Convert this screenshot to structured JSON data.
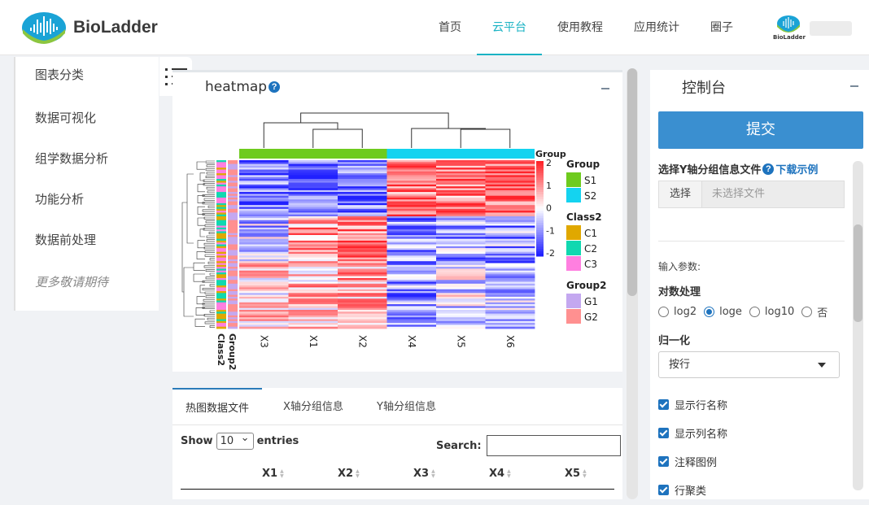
{
  "header": {
    "brand": "BioLadder",
    "nav": [
      "首页",
      "云平台",
      "使用教程",
      "应用统计",
      "圈子"
    ],
    "active_nav": "云平台",
    "avatar_brand": "BioLadder"
  },
  "sidebar": {
    "items": [
      "图表分类",
      "数据可视化",
      "组学数据分析",
      "功能分析",
      "数据前处理"
    ],
    "more": "更多敬请期待"
  },
  "panel": {
    "title": "heatmap",
    "help": "?"
  },
  "heatmap": {
    "columns": [
      "X3",
      "X1",
      "X2",
      "X4",
      "X5",
      "X6"
    ],
    "side_labels": [
      "Class2",
      "Group2"
    ],
    "top_annotation_label": "Group",
    "colorbar_ticks": [
      "2",
      "1",
      "0",
      "-1",
      "-2"
    ],
    "colors": {
      "high": "#e8232a",
      "mid": "#ffffff",
      "low": "#2020e0",
      "group_s1": "#6ecb1e",
      "group_s2": "#14d3f0"
    },
    "legends": [
      {
        "title": "Group",
        "items": [
          {
            "label": "S1",
            "color": "#6ecb1e"
          },
          {
            "label": "S2",
            "color": "#14d3f0"
          }
        ]
      },
      {
        "title": "Class2",
        "items": [
          {
            "label": "C1",
            "color": "#e0a800"
          },
          {
            "label": "C2",
            "color": "#10d8b0"
          },
          {
            "label": "C3",
            "color": "#ff7fe0"
          }
        ]
      },
      {
        "title": "Group2",
        "items": [
          {
            "label": "G1",
            "color": "#c4a8f0"
          },
          {
            "label": "G2",
            "color": "#ff9090"
          }
        ]
      }
    ]
  },
  "tabs": [
    "热图数据文件",
    "X轴分组信息",
    "Y轴分组信息"
  ],
  "table": {
    "show": "Show",
    "entries_value": "10",
    "entries": "entries",
    "search": "Search:",
    "columns": [
      "X1",
      "X2",
      "X3",
      "X4",
      "X5"
    ]
  },
  "console": {
    "title": "控制台",
    "submit": "提交",
    "file_label": "选择Y轴分组信息文件",
    "download": "下载示例",
    "file_button": "选择",
    "file_placeholder": "未选择文件",
    "input_params": "输入参数:",
    "log_label": "对数处理",
    "log_options": [
      "log2",
      "loge",
      "log10",
      "否"
    ],
    "log_selected": "loge",
    "normalize_label": "归一化",
    "normalize_value": "按行",
    "checks": [
      "显示行名称",
      "显示列名称",
      "注释图例",
      "行聚类"
    ]
  }
}
